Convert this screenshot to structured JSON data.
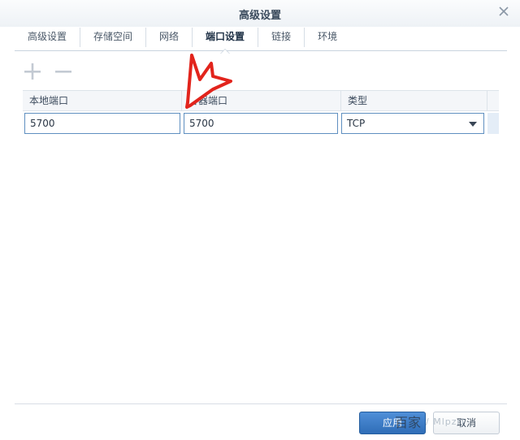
{
  "window": {
    "title": "高级设置",
    "close_icon": "close-icon"
  },
  "tabs": [
    {
      "label": "高级设置",
      "active": false
    },
    {
      "label": "存储空间",
      "active": false
    },
    {
      "label": "网络",
      "active": false
    },
    {
      "label": "端口设置",
      "active": true
    },
    {
      "label": "链接",
      "active": false
    },
    {
      "label": "环境",
      "active": false
    }
  ],
  "toolbar": {
    "add_icon": "plus-icon",
    "remove_icon": "minus-icon"
  },
  "grid": {
    "columns": [
      "本地端口",
      "容器端口",
      "类型"
    ],
    "rows": [
      {
        "local_port": "5700",
        "container_port": "5700",
        "type": "TCP"
      }
    ]
  },
  "footer": {
    "apply_label": "应用",
    "cancel_label": "取消"
  },
  "watermark": {
    "text": "百家",
    "sub": "/ Mlpzrl"
  },
  "colors": {
    "accent": "#2f6db7",
    "annotation_arrow": "#e2241c"
  }
}
